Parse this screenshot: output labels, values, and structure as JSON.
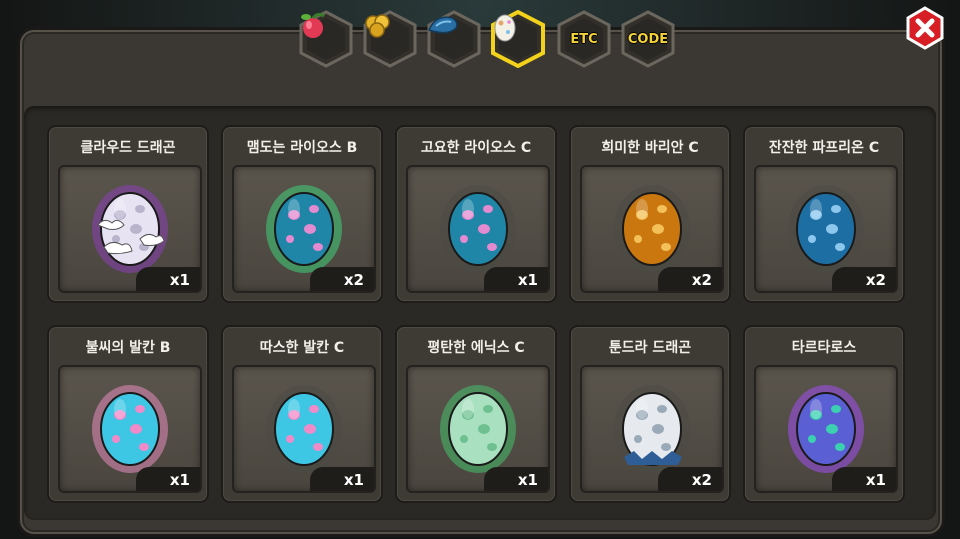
{
  "tabs": [
    {
      "id": "fruit",
      "icon": "fruit-icon",
      "label": "",
      "active": false
    },
    {
      "id": "gold",
      "icon": "gold-coins-icon",
      "label": "",
      "active": false
    },
    {
      "id": "material",
      "icon": "blue-material-icon",
      "label": "",
      "active": false
    },
    {
      "id": "egg",
      "icon": "egg-icon",
      "label": "",
      "active": true
    },
    {
      "id": "etc",
      "icon": "",
      "label": "ETC",
      "active": false
    },
    {
      "id": "code",
      "icon": "",
      "label": "CODE",
      "active": false
    }
  ],
  "close": {
    "icon": "close-icon"
  },
  "eggs": [
    {
      "name": "클라우드 드래곤",
      "count": "x1",
      "icon": "cloud-dragon-egg-icon",
      "color": "#e7e3f3",
      "spot": "#b9b3cc",
      "glow": "#8a3fb5"
    },
    {
      "name": "맴도는 라이오스 B",
      "count": "x2",
      "icon": "lios-egg-icon",
      "color": "#1f86a8",
      "spot": "#e38ad0",
      "glow": "#3fd07a"
    },
    {
      "name": "고요한 라이오스 C",
      "count": "x1",
      "icon": "lios-egg-icon",
      "color": "#1f86a8",
      "spot": "#e38ad0",
      "glow": "#4a4a44"
    },
    {
      "name": "희미한 바리안 C",
      "count": "x2",
      "icon": "varian-egg-icon",
      "color": "#c9770e",
      "spot": "#f3c05a",
      "glow": "#4a4a44"
    },
    {
      "name": "잔잔한 파프리온 C",
      "count": "x2",
      "icon": "paprion-egg-icon",
      "color": "#1d6fa3",
      "spot": "#8ec7ee",
      "glow": "#4a4a44"
    },
    {
      "name": "불씨의 발칸 B",
      "count": "x1",
      "icon": "vulcan-egg-icon",
      "color": "#3dc7e4",
      "spot": "#f08ac8",
      "glow": "#e58cbd"
    },
    {
      "name": "따스한 발칸 C",
      "count": "x1",
      "icon": "vulcan-egg-icon",
      "color": "#3dc7e4",
      "spot": "#f08ac8",
      "glow": "#4a4a44"
    },
    {
      "name": "평탄한 에닉스 C",
      "count": "x1",
      "icon": "enix-egg-icon",
      "color": "#a9e0c0",
      "spot": "#6fc091",
      "glow": "#45c06b"
    },
    {
      "name": "툰드라 드래곤",
      "count": "x2",
      "icon": "tundra-dragon-egg-icon",
      "color": "#e6eaee",
      "spot": "#9aaab8",
      "glow": "#4a4a44"
    },
    {
      "name": "타르타로스",
      "count": "x1",
      "icon": "tartaros-egg-icon",
      "color": "#5a5fd3",
      "spot": "#3bd0b0",
      "glow": "#a04ef0"
    }
  ]
}
